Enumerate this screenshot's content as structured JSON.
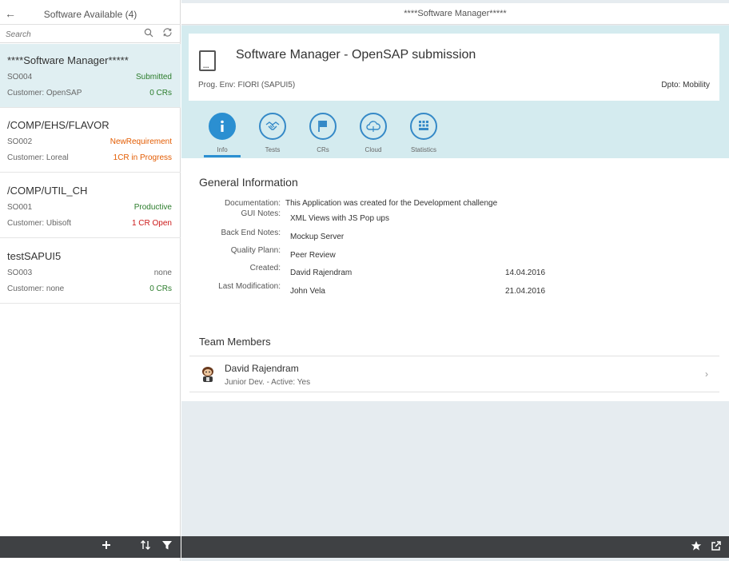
{
  "master": {
    "title": "Software Available (4)",
    "search_placeholder": "Search",
    "items": [
      {
        "title": "****Software Manager*****",
        "number": "SO004",
        "status": "Submitted",
        "customer": "Customer: OpenSAP",
        "info": "0 CRs"
      },
      {
        "title": "/COMP/EHS/FLAVOR",
        "number": "SO002",
        "status": "NewRequirement",
        "customer": "Customer: Loreal",
        "info": "1CR in Progress"
      },
      {
        "title": "/COMP/UTIL_CH",
        "number": "SO001",
        "status": "Productive",
        "customer": "Customer: Ubisoft",
        "info": "1 CR Open"
      },
      {
        "title": "testSAPUI5",
        "number": "SO003",
        "status": "none",
        "customer": "Customer: none",
        "info": "0 CRs"
      }
    ],
    "footer_icons": [
      "add-icon",
      "sort-icon",
      "filter-icon"
    ]
  },
  "detail": {
    "title": "****Software Manager*****",
    "object": {
      "title": "Software Manager - OpenSAP submission",
      "attribute_left": "Prog. Env: FIORI (SAPUI5)",
      "attribute_right": "Dpto: Mobility"
    },
    "tabs": [
      {
        "label": "Info",
        "icon": "info-icon",
        "active": true
      },
      {
        "label": "Tests",
        "icon": "handshake-icon",
        "active": false
      },
      {
        "label": "CRs",
        "icon": "flag-icon",
        "active": false
      },
      {
        "label": "Cloud",
        "icon": "cloud-icon",
        "active": false
      },
      {
        "label": "Statistics",
        "icon": "grid-icon",
        "active": false
      }
    ],
    "general_info": {
      "title": "General Information",
      "rows": [
        {
          "label": "Documentation:",
          "value": "This Application was created for the Development challenge",
          "date": ""
        },
        {
          "label": "GUI Notes:",
          "value": "XML Views with JS Pop ups",
          "date": ""
        },
        {
          "label": "Back End Notes:",
          "value": "Mockup Server",
          "date": ""
        },
        {
          "label": "Quality Plann:",
          "value": "Peer Review",
          "date": ""
        },
        {
          "label": "Created:",
          "value": "David Rajendram",
          "date": "14.04.2016"
        },
        {
          "label": "Last Modification:",
          "value": "John Vela",
          "date": "21.04.2016"
        }
      ]
    },
    "team": {
      "title": "Team Members",
      "members": [
        {
          "name": "David Rajendram",
          "description": "Junior Dev. - Active: Yes"
        }
      ]
    },
    "footer_icons": [
      "favorite-icon",
      "share-icon"
    ]
  },
  "colors": {
    "accent": "#2b8fd1",
    "positive": "#2b7c2b",
    "critical": "#e35b00",
    "negative": "#cc1919",
    "footer": "#3f4144",
    "selected": "#e0eff2"
  }
}
